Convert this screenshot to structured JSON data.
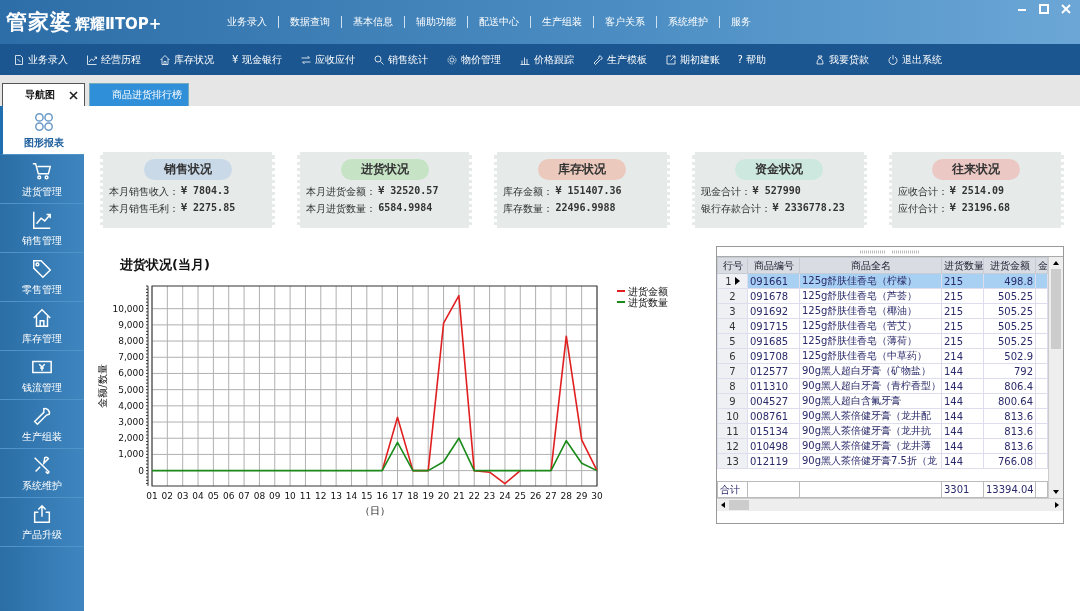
{
  "app": {
    "logo": "管家婆",
    "edition": "辉耀ⅡTOP+"
  },
  "menu": [
    "业务录入",
    "数据查询",
    "基本信息",
    "辅助功能",
    "配送中心",
    "生产组装",
    "客户关系",
    "系统维护",
    "服务"
  ],
  "toolbar": {
    "items": [
      "业务录入",
      "经营历程",
      "库存状况",
      "¥ 现金银行",
      "应收应付",
      "销售统计",
      "物价管理",
      "价格跟踪",
      "生产模板",
      "期初建账",
      "? 帮助"
    ],
    "right_items": [
      "我要贷款",
      "退出系统"
    ]
  },
  "tabs": [
    {
      "label": "导航图",
      "selected": true,
      "closable": true
    },
    {
      "label": "商品进货排行榜",
      "selected": false,
      "closable": false
    }
  ],
  "sidebar": [
    {
      "label": "图形报表",
      "selected": true
    },
    {
      "label": "进货管理",
      "selected": false
    },
    {
      "label": "销售管理",
      "selected": false
    },
    {
      "label": "零售管理",
      "selected": false
    },
    {
      "label": "库存管理",
      "selected": false
    },
    {
      "label": "钱流管理",
      "selected": false
    },
    {
      "label": "生产组装",
      "selected": false
    },
    {
      "label": "系统维护",
      "selected": false
    },
    {
      "label": "产品升级",
      "selected": false
    }
  ],
  "cards": [
    {
      "title": "销售状况",
      "color": "#c9d9e8",
      "lines": [
        {
          "label": "本月销售收入：",
          "value": "¥ 7804.3"
        },
        {
          "label": "本月销售毛利：",
          "value": "¥ 2275.85"
        }
      ]
    },
    {
      "title": "进货状况",
      "color": "#c6e3c6",
      "lines": [
        {
          "label": "本月进货金额：",
          "value": "¥ 32520.57"
        },
        {
          "label": "本月进货数量：",
          "value": "6584.9984"
        }
      ]
    },
    {
      "title": "库存状况",
      "color": "#ebcabd",
      "lines": [
        {
          "label": "库存金额：",
          "value": "¥ 151407.36"
        },
        {
          "label": "库存数量：",
          "value": "22496.9988"
        }
      ]
    },
    {
      "title": "资金状况",
      "color": "#cde8df",
      "lines": [
        {
          "label": "现金合计：",
          "value": "¥ 527990"
        },
        {
          "label": "银行存款合计：",
          "value": "¥ 2336778.23"
        }
      ]
    },
    {
      "title": "往来状况",
      "color": "#ebc8c3",
      "lines": [
        {
          "label": "应收合计：",
          "value": "¥ 2514.09"
        },
        {
          "label": "应付合计：",
          "value": "¥ 23196.68"
        }
      ]
    }
  ],
  "purchase_chart": {
    "chart_data": {
      "type": "line",
      "title": "进货状况(当月)",
      "xlabel": "（日）",
      "ylabel": "金额/数量",
      "categories": [
        "01",
        "02",
        "03",
        "04",
        "05",
        "06",
        "07",
        "08",
        "09",
        "10",
        "11",
        "12",
        "13",
        "14",
        "15",
        "16",
        "17",
        "18",
        "19",
        "20",
        "21",
        "22",
        "23",
        "24",
        "25",
        "26",
        "27",
        "28",
        "29",
        "30"
      ],
      "series": [
        {
          "name": "进货金额",
          "color": "#e02020",
          "values": [
            null,
            null,
            null,
            null,
            null,
            null,
            null,
            null,
            null,
            null,
            null,
            null,
            null,
            null,
            null,
            0,
            3300,
            0,
            0,
            9100,
            10800,
            0,
            -100,
            -800,
            0,
            null,
            0,
            8300,
            1900,
            0
          ]
        },
        {
          "name": "进货数量",
          "color": "#1a8a1a",
          "values": [
            0,
            0,
            0,
            0,
            0,
            0,
            0,
            0,
            0,
            0,
            0,
            0,
            0,
            0,
            0,
            0,
            1750,
            0,
            0,
            550,
            2000,
            0,
            0,
            0,
            0,
            0,
            0,
            1850,
            450,
            0
          ]
        }
      ],
      "ylim": [
        -950,
        11400
      ],
      "grid": true,
      "legend": true,
      "yticks": [
        {
          "value": 0,
          "label": "0"
        },
        {
          "value": 1000,
          "label": "1,000"
        },
        {
          "value": 2000,
          "label": "2,000"
        },
        {
          "value": 3000,
          "label": "3,000"
        },
        {
          "value": 4000,
          "label": "4,000"
        },
        {
          "value": 5000,
          "label": "5,000"
        },
        {
          "value": 6000,
          "label": "6,000"
        },
        {
          "value": 7000,
          "label": "7,000"
        },
        {
          "value": 8000,
          "label": "8,000"
        },
        {
          "value": 9000,
          "label": "9,000"
        },
        {
          "value": 10000,
          "label": "10,000"
        }
      ]
    }
  },
  "ranking_table": {
    "columns": [
      "行号",
      "商品编号",
      "商品全名",
      "进货数量",
      "进货金额",
      "金"
    ],
    "rows": [
      {
        "no": "1",
        "code": "091661",
        "name": "125g舒肤佳香皂（柠檬）",
        "qty": "215",
        "amount": "498.8",
        "selected": true
      },
      {
        "no": "2",
        "code": "091678",
        "name": "125g舒肤佳香皂（芦荟）",
        "qty": "215",
        "amount": "505.25",
        "selected": false
      },
      {
        "no": "3",
        "code": "091692",
        "name": "125g舒肤佳香皂（椰油）",
        "qty": "215",
        "amount": "505.25",
        "selected": false
      },
      {
        "no": "4",
        "code": "091715",
        "name": "125g舒肤佳香皂（苦艾）",
        "qty": "215",
        "amount": "505.25",
        "selected": false
      },
      {
        "no": "5",
        "code": "091685",
        "name": "125g舒肤佳香皂（薄荷）",
        "qty": "215",
        "amount": "505.25",
        "selected": false
      },
      {
        "no": "6",
        "code": "091708",
        "name": "125g舒肤佳香皂（中草药）",
        "qty": "214",
        "amount": "502.9",
        "selected": false
      },
      {
        "no": "7",
        "code": "012577",
        "name": "90g黑人超白牙膏（矿物盐）",
        "qty": "144",
        "amount": "792",
        "selected": false
      },
      {
        "no": "8",
        "code": "011310",
        "name": "90g黑人超白牙膏（青柠香型）",
        "qty": "144",
        "amount": "806.4",
        "selected": false
      },
      {
        "no": "9",
        "code": "004527",
        "name": "90g黑人超白含氟牙膏",
        "qty": "144",
        "amount": "800.64",
        "selected": false
      },
      {
        "no": "10",
        "code": "008761",
        "name": "90g黑人茶倍健牙膏（龙井配",
        "qty": "144",
        "amount": "813.6",
        "selected": false
      },
      {
        "no": "11",
        "code": "015134",
        "name": "90g黑人茶倍健牙膏（龙井抗",
        "qty": "144",
        "amount": "813.6",
        "selected": false
      },
      {
        "no": "12",
        "code": "010498",
        "name": "90g黑人茶倍健牙膏（龙井薄",
        "qty": "144",
        "amount": "813.6",
        "selected": false
      },
      {
        "no": "13",
        "code": "012119",
        "name": "90g黑人茶倍健牙膏7.5折（龙",
        "qty": "144",
        "amount": "766.08",
        "selected": false
      }
    ],
    "footer": {
      "label": "合计",
      "qty": "3301",
      "amount": "13394.04"
    }
  }
}
